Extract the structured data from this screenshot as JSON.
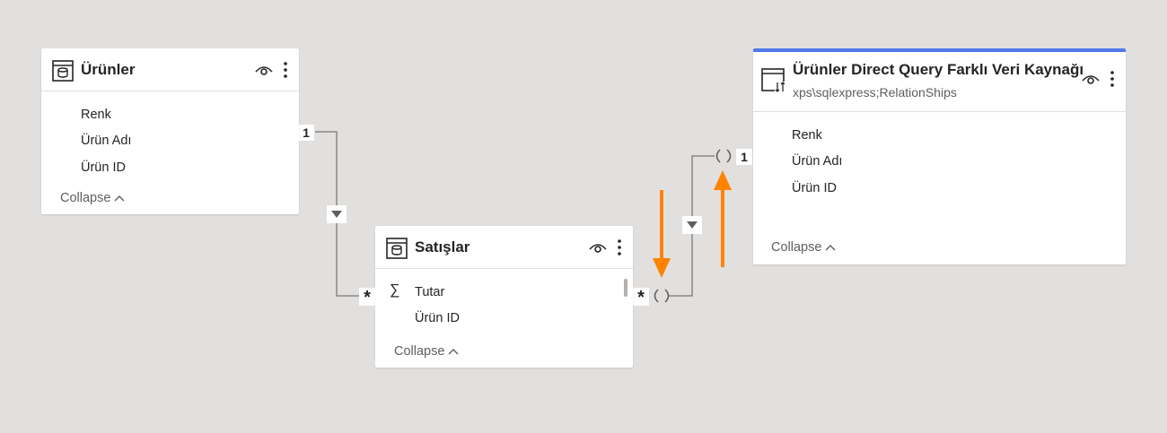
{
  "tables": [
    {
      "id": "urunler",
      "title": "Ürünler",
      "fields": [
        "Renk",
        "Ürün Adı",
        "Ürün ID"
      ],
      "collapse_label": "Collapse"
    },
    {
      "id": "satislar",
      "title": "Satışlar",
      "fields": [
        "Tutar",
        "Ürün ID"
      ],
      "collapse_label": "Collapse"
    },
    {
      "id": "urunler_dq",
      "title": "Ürünler Direct Query Farklı Veri Kaynağı",
      "subtitle": "xps\\sqlexpress;RelationShips",
      "fields": [
        "Renk",
        "Ürün Adı",
        "Ürün ID"
      ],
      "collapse_label": "Collapse",
      "accent_color": "#4f78e8"
    }
  ],
  "relationships": [
    {
      "from_cardinality": "1",
      "to_cardinality": "*"
    },
    {
      "from_cardinality": "*",
      "to_cardinality": "1"
    }
  ],
  "annotation": {
    "arrow_color": "#ff8200"
  },
  "icons": {
    "table": "table-icon",
    "directquery_table": "directquery-table-icon",
    "visibility": "eye-icon",
    "more": "more-options-icon",
    "sigma": "sigma-icon",
    "filter_direction": "filter-direction-icon",
    "limited_relationship": "limited-relationship-icon",
    "collapse": "chevron-up-icon"
  },
  "sigma_symbol": "∑"
}
